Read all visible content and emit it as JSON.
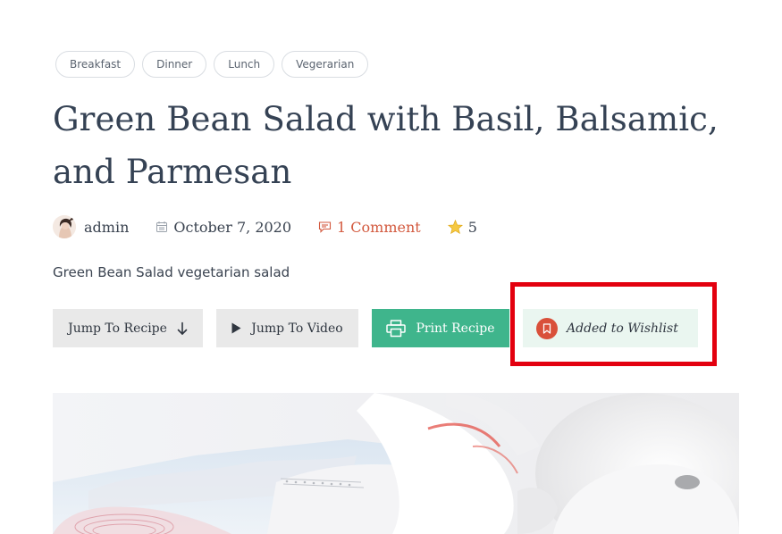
{
  "tags": [
    "Breakfast",
    "Dinner",
    "Lunch",
    "Vegerarian"
  ],
  "post": {
    "title": "Green Bean Salad with Basil, Balsamic, and Parmesan",
    "author": "admin",
    "date": "October 7, 2020",
    "comments": "1 Comment",
    "rating": "5",
    "subtitle": "Green Bean Salad vegetarian salad"
  },
  "actions": {
    "jump_recipe": "Jump To Recipe",
    "jump_video": "Jump To Video",
    "print_recipe": "Print Recipe",
    "wishlist": "Added to Wishlist"
  },
  "icons": {
    "jump_recipe": "arrow-down-icon",
    "jump_video": "play-icon",
    "print_recipe": "printer-icon",
    "wishlist": "bookmark-icon",
    "date": "calendar-icon",
    "comments": "comment-icon",
    "rating": "star-icon"
  },
  "colors": {
    "print_button": "#3fb58c",
    "wishlist_button_bg": "#eaf6f0",
    "wishlist_icon": "#d9503a",
    "comment_link": "#d35a3f",
    "highlight_box": "#e3000f"
  }
}
